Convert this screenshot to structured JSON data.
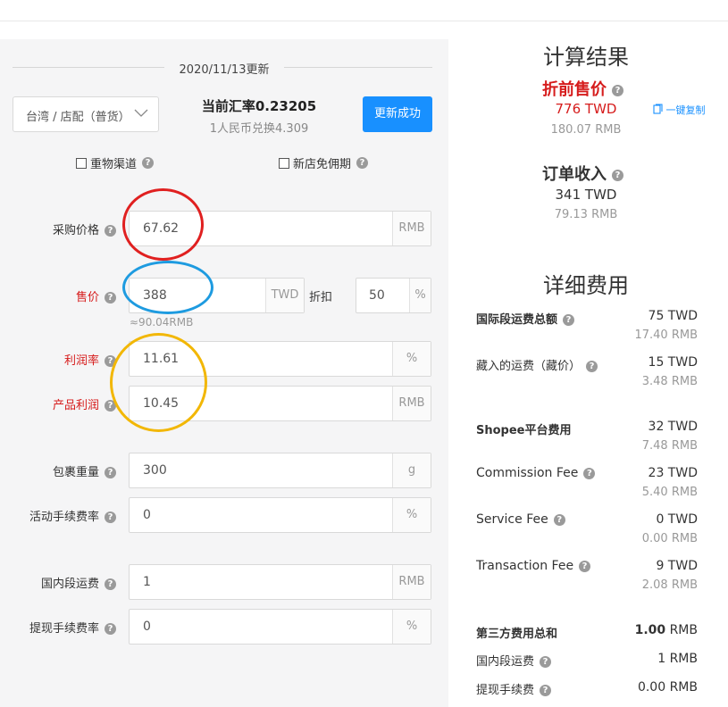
{
  "date_header": "2020/11/13更新",
  "channel_select": "台湾 / 店配（普货）",
  "exchange": {
    "rate_label": "当前汇率0.23205",
    "conversion": "1人民币兑换4.309"
  },
  "update_button": "更新成功",
  "options": {
    "heavy_channel": "重物渠道",
    "new_store": "新店免佣期"
  },
  "form": {
    "purchase_price": {
      "label": "采购价格",
      "value": "67.62",
      "unit": "RMB"
    },
    "sale_price": {
      "label": "售价",
      "value": "388",
      "unit": "TWD",
      "approx": "≈90.04RMB"
    },
    "discount": {
      "label": "折扣",
      "value": "50",
      "unit": "%"
    },
    "profit_rate": {
      "label": "利润率",
      "value": "11.61",
      "unit": "%"
    },
    "product_profit": {
      "label": "产品利润",
      "value": "10.45",
      "unit": "RMB"
    },
    "package_weight": {
      "label": "包裹重量",
      "value": "300",
      "unit": "g"
    },
    "activity_fee_rate": {
      "label": "活动手续费率",
      "value": "0",
      "unit": "%"
    },
    "domestic_shipping": {
      "label": "国内段运费",
      "value": "1",
      "unit": "RMB"
    },
    "withdraw_fee_rate": {
      "label": "提现手续费率",
      "value": "0",
      "unit": "%"
    }
  },
  "result": {
    "title": "计算结果",
    "pre_discount_label": "折前售价",
    "pre_discount_twd": "776 TWD",
    "pre_discount_rmb": "180.07 RMB",
    "copy_label": "一键复制",
    "order_income_label": "订单收入",
    "order_income_twd": "341 TWD",
    "order_income_rmb": "79.13 RMB"
  },
  "details": {
    "title": "详细费用",
    "rows": [
      {
        "label": "国际段运费总额",
        "twd": "75 TWD",
        "rmb": "17.40 RMB"
      },
      {
        "label": "藏入的运费（藏价）",
        "twd": "15 TWD",
        "rmb": "3.48 RMB"
      },
      {
        "label": "Shopee平台费用",
        "twd": "32 TWD",
        "rmb": "7.48 RMB"
      },
      {
        "label": "Commission Fee",
        "twd": "23 TWD",
        "rmb": "5.40 RMB"
      },
      {
        "label": "Service Fee",
        "twd": "0 TWD",
        "rmb": "0.00 RMB"
      },
      {
        "label": "Transaction Fee",
        "twd": "9 TWD",
        "rmb": "2.08 RMB"
      }
    ],
    "third_party": {
      "label": "第三方费用总和",
      "value": "1.00",
      "unit": "RMB"
    },
    "domestic": {
      "label": "国内段运费",
      "value": "1 RMB"
    },
    "withdraw": {
      "label": "提现手续费",
      "value": "0.00 RMB"
    }
  },
  "colors": {
    "accent": "#1890ff",
    "red": "#d61c1c",
    "annotation_red": "#e02020",
    "annotation_blue": "#1e9be0",
    "annotation_yellow": "#f2b705"
  }
}
